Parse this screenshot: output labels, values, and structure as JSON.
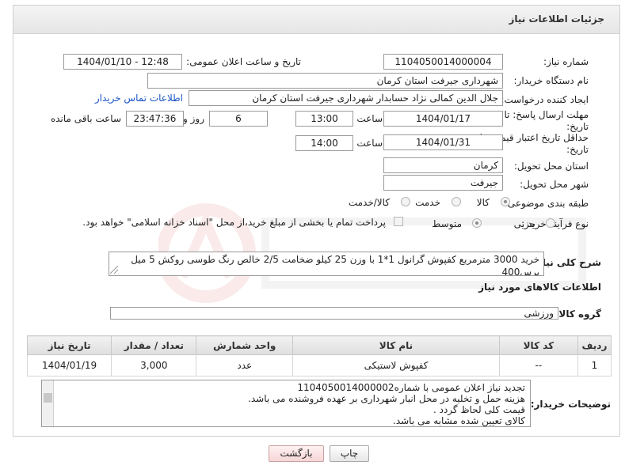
{
  "page": {
    "title": "جزئیات اطلاعات نیاز",
    "colors": {
      "header_bg": "#ececec",
      "link": "#1b55c7",
      "back_button": "#f6d6d6"
    }
  },
  "form": {
    "need_number": {
      "label": "شماره نیاز:",
      "value": "1104050014000004"
    },
    "announce_datetime": {
      "label": "تاریخ و ساعت اعلان عمومی:",
      "value": "1404/01/10 - 12:48"
    },
    "buyer_org": {
      "label": "نام دستگاه خریدار:",
      "value": "شهرداری جیرفت استان کرمان"
    },
    "requester": {
      "label": "ایجاد کننده درخواست:",
      "value": "جلال الدین کمالی نژاد حسابدار شهرداری جیرفت استان کرمان",
      "contact_link": "اطلاعات تماس خریدار"
    },
    "reply_deadline": {
      "label_line1": "مهلت ارسال پاسخ: تا",
      "label_line2": "تاریخ:",
      "date": "1404/01/17",
      "time_label": "ساعت",
      "time": "13:00",
      "days": "6",
      "days_label": "روز و",
      "remaining": "23:47:36",
      "remaining_label": "ساعت باقی مانده"
    },
    "price_validity": {
      "label_line1": "حداقل تاریخ اعتبار قیمت: تا",
      "label_line2": "تاریخ:",
      "date": "1404/01/31",
      "time_label": "ساعت",
      "time": "14:00"
    },
    "delivery_province": {
      "label": "استان محل تحویل:",
      "value": "کرمان"
    },
    "delivery_city": {
      "label": "شهر محل تحویل:",
      "value": "جیرفت"
    },
    "category": {
      "label": "طبقه بندی موضوعی:",
      "options": [
        {
          "label": "کالا",
          "selected": true
        },
        {
          "label": "خدمت",
          "selected": false
        },
        {
          "label": "کالا/خدمت",
          "selected": false
        }
      ]
    },
    "purchase_process": {
      "label": "نوع فرآیند خرید :",
      "options": [
        {
          "label": "جزیی",
          "selected": false
        },
        {
          "label": "متوسط",
          "selected": true
        }
      ],
      "payment_note": "پرداخت تمام یا بخشی از مبلغ خرید،از محل \"اسناد خزانه اسلامی\" خواهد بود."
    },
    "description": {
      "label": "شرح کلی نیاز:",
      "value": "خرید 3000 مترمربع کفپوش گرانول 1*1 با وزن 25 کیلو ضخامت 2/5 خالص  رنگ طوسی روکش 5 میل پرس400"
    }
  },
  "goods": {
    "section_title": "اطلاعات کالاهای مورد نیاز",
    "group": {
      "label": "گروه کالا:",
      "value": "ورزشی"
    },
    "table": {
      "headers": [
        "ردیف",
        "کد کالا",
        "نام کالا",
        "واحد شمارش",
        "تعداد / مقدار",
        "تاریخ نیاز"
      ],
      "rows": [
        {
          "row": "1",
          "code": "--",
          "name": "کفپوش لاستیکی",
          "unit": "عدد",
          "qty": "3,000",
          "date": "1404/01/19"
        }
      ]
    }
  },
  "buyer_notes": {
    "label": "توضیحات خریدار:",
    "lines": [
      "تجدید نیاز اعلان عمومی با شماره1104050014000002",
      "هزینه حمل و تخلیه در محل انبار شهرداری بر عهده فروشنده می باشد.",
      "قیمت کلی لحاظ گردد .",
      "کالای تعیین شده مشابه می باشد."
    ]
  },
  "buttons": {
    "print": "چاپ",
    "back": "بازگشت"
  }
}
